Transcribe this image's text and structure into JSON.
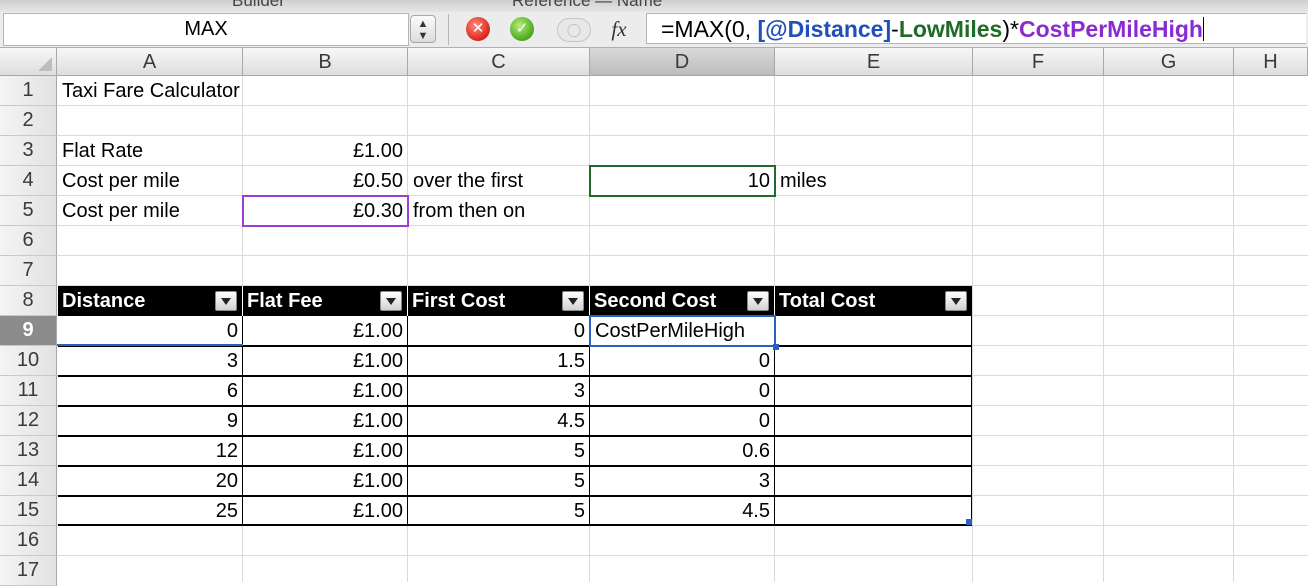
{
  "ribbon": {
    "left_label": "Builder",
    "right_label": "Reference — Name"
  },
  "formula_bar": {
    "name_box": "MAX",
    "fx": "fx",
    "formula_parts": [
      "=MAX(0, ",
      "[@Distance]",
      "-",
      "LowMiles",
      ")*",
      "CostPerMileHigh"
    ]
  },
  "columns": [
    "A",
    "B",
    "C",
    "D",
    "E",
    "F",
    "G",
    "H"
  ],
  "rows": [
    "1",
    "2",
    "3",
    "4",
    "5",
    "6",
    "7",
    "8",
    "9",
    "10",
    "11",
    "12",
    "13",
    "14",
    "15",
    "16",
    "17"
  ],
  "cells": {
    "A1": "Taxi Fare Calculator",
    "A3": "Flat Rate",
    "B3": "£1.00",
    "A4": "Cost per mile",
    "B4": "£0.50",
    "C4": "over the first",
    "D4": "10",
    "E4": "miles",
    "A5": "Cost per mile",
    "B5": "£0.30",
    "C5": "from then on"
  },
  "table": {
    "headers": [
      "Distance",
      "Flat Fee",
      "First Cost",
      "Second Cost",
      "Total Cost"
    ],
    "rows": [
      [
        "0",
        "£1.00",
        "0",
        "CostPerMileHigh",
        ""
      ],
      [
        "3",
        "£1.00",
        "1.5",
        "0",
        ""
      ],
      [
        "6",
        "£1.00",
        "3",
        "0",
        ""
      ],
      [
        "9",
        "£1.00",
        "4.5",
        "0",
        ""
      ],
      [
        "12",
        "£1.00",
        "5",
        "0.6",
        ""
      ],
      [
        "20",
        "£1.00",
        "5",
        "3",
        ""
      ],
      [
        "25",
        "£1.00",
        "5",
        "4.5",
        ""
      ]
    ]
  },
  "colors": {
    "ref_distance": "#1f4fb8",
    "ref_lowmiles": "#1d6b27",
    "ref_costhigh": "#8a2bd1",
    "table_header_bg": "#000000"
  }
}
